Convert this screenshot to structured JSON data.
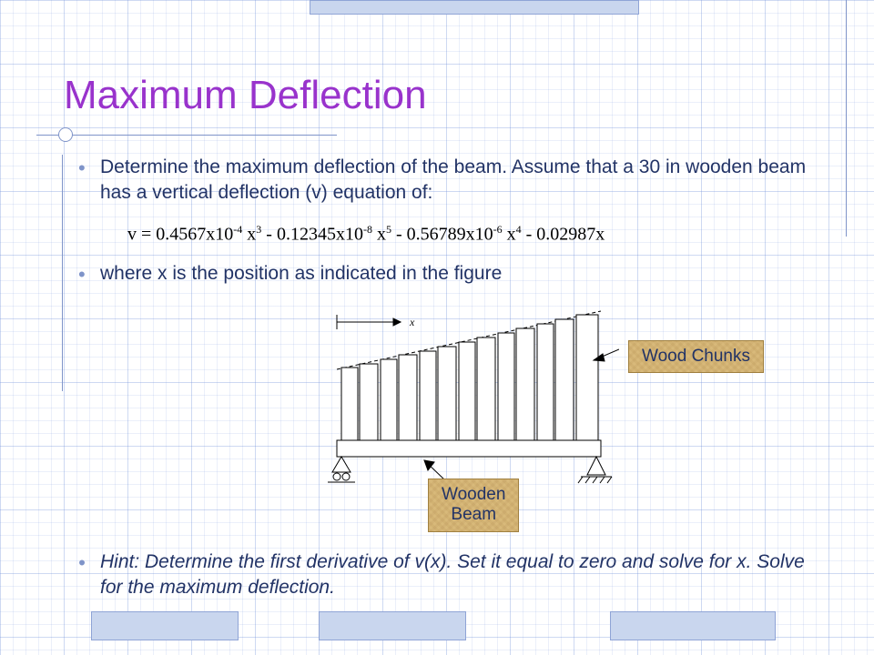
{
  "title": "Maximum Deflection",
  "bullets": {
    "b1": "Determine the maximum deflection of the beam. Assume that a 30 in wooden beam has a vertical deflection (v) equation of:",
    "b2": "where x is the position as indicated in the figure",
    "b3": "Hint: Determine the first derivative of v(x). Set it equal to zero and solve for x. Solve for the maximum deflection."
  },
  "equation": {
    "lhs": "v",
    "eq": "=",
    "t1_coef": "0.4567x10",
    "t1_exp10": "-4",
    "t1_var": "x",
    "t1_pow": "3",
    "t2_coef": "0.12345x10",
    "t2_exp10": "-8",
    "t2_var": "x",
    "t2_pow": "5",
    "t3_coef": "0.56789x10",
    "t3_exp10": "-6",
    "t3_var": "x",
    "t3_pow": "4",
    "t4_coef": "0.02987x",
    "minus": "-"
  },
  "figure": {
    "x_label": "x",
    "label_chunks": "Wood Chunks",
    "label_beam_l1": "Wooden",
    "label_beam_l2": "Beam"
  }
}
